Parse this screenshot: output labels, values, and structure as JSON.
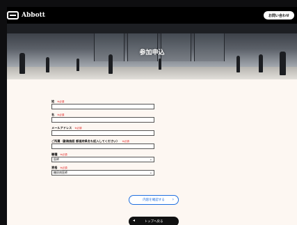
{
  "header": {
    "brand": "Abbott",
    "contact_button": "お問い合わせ",
    "logo_icon": "abbott-logo-icon"
  },
  "hero": {
    "title": "参加申込"
  },
  "form": {
    "required_label": "※必須",
    "last_name": {
      "label": "姓",
      "value": ""
    },
    "first_name": {
      "label": "名",
      "value": ""
    },
    "email": {
      "label": "メールアドレス",
      "value": ""
    },
    "affiliation": {
      "label": "ご所属（勤務施設 都道府県名も記入してください）",
      "value": ""
    },
    "occupation": {
      "label": "職種",
      "value": "医師"
    },
    "specialty": {
      "label": "資格",
      "value": "糖尿病医師"
    }
  },
  "actions": {
    "confirm": "内容を確認する",
    "back_top": "トップへ戻る"
  },
  "colors": {
    "accent": "#1f6fe0",
    "required": "#e02020",
    "header_bg": "#000000",
    "page_bg": "#fdf7f2"
  }
}
